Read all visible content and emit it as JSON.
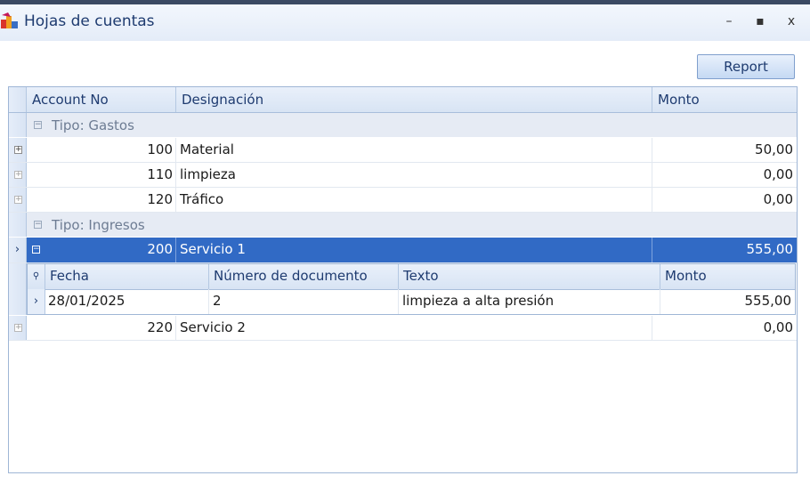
{
  "window": {
    "title": "Hojas de cuentas",
    "minimize_label": "–",
    "maximize_label": "▪",
    "close_label": "x"
  },
  "toolbar": {
    "report_label": "Report"
  },
  "grid": {
    "columns": [
      "Account No",
      "Designación",
      "Monto"
    ],
    "groups": [
      {
        "label": "Tipo: Gastos",
        "rows": [
          {
            "account": "100",
            "designation": "Material",
            "amount": "50,00"
          },
          {
            "account": "110",
            "designation": "limpieza",
            "amount": "0,00"
          },
          {
            "account": "120",
            "designation": "Tráfico",
            "amount": "0,00"
          }
        ]
      },
      {
        "label": "Tipo: Ingresos",
        "rows": [
          {
            "account": "200",
            "designation": "Servicio 1",
            "amount": "555,00",
            "selected": true,
            "expanded": true
          },
          {
            "account": "220",
            "designation": "Servicio 2",
            "amount": "0,00"
          }
        ]
      }
    ]
  },
  "detail": {
    "columns": [
      "Fecha",
      "Número de documento",
      "Texto",
      "Monto"
    ],
    "rows": [
      {
        "date": "28/01/2025",
        "doc_no": "2",
        "text": "limpieza a alta presión",
        "amount": "555,00"
      }
    ]
  },
  "colors": {
    "selection": "#316ac5",
    "header": "#dbe6f5",
    "title_text": "#1e3b70"
  }
}
